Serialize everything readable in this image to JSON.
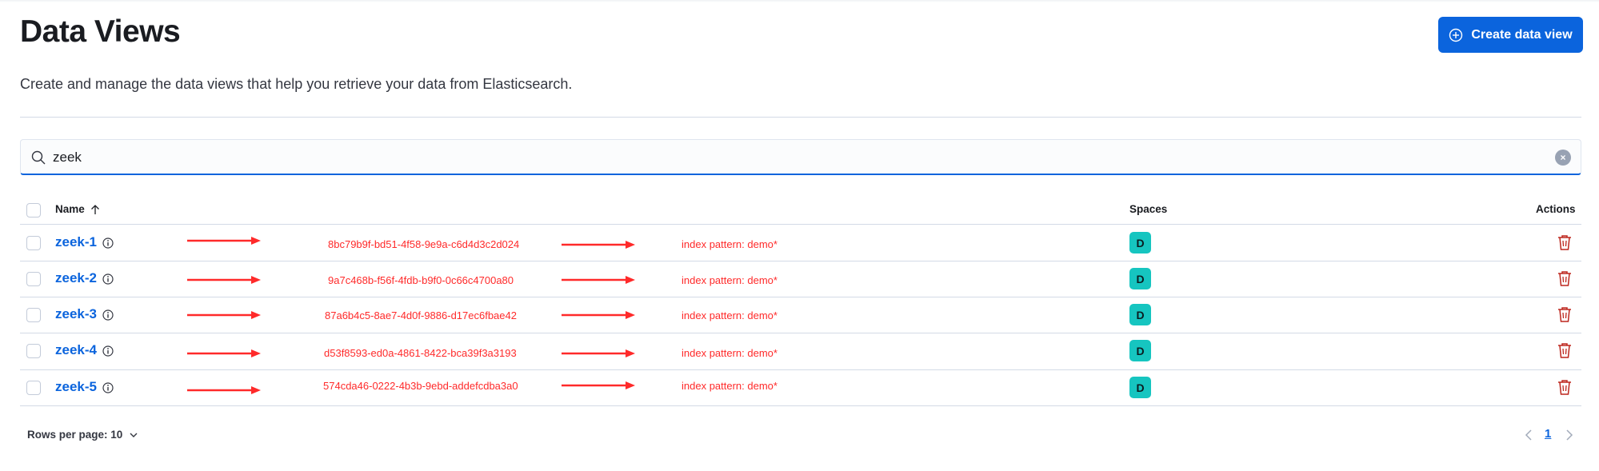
{
  "header": {
    "title": "Data Views",
    "subtitle": "Create and manage the data views that help you retrieve your data from Elasticsearch.",
    "create_button_label": "Create data view",
    "create_button_icon": "plus-circle-icon"
  },
  "search": {
    "value": "zeek"
  },
  "table": {
    "columns": {
      "name": "Name",
      "spaces": "Spaces",
      "actions": "Actions"
    },
    "rows": [
      {
        "name": "zeek-1",
        "annotation_id": "8bc79b9f-bd51-4f58-9e9a-c6d4d3c2d024",
        "annotation_pattern": "index pattern: demo*",
        "space_badge": "D"
      },
      {
        "name": "zeek-2",
        "annotation_id": "9a7c468b-f56f-4fdb-b9f0-0c66c4700a80",
        "annotation_pattern": "index pattern: demo*",
        "space_badge": "D"
      },
      {
        "name": "zeek-3",
        "annotation_id": "87a6b4c5-8ae7-4d0f-9886-d17ec6fbae42",
        "annotation_pattern": "index pattern: demo*",
        "space_badge": "D"
      },
      {
        "name": "zeek-4",
        "annotation_id": "d53f8593-ed0a-4861-8422-bca39f3a3193",
        "annotation_pattern": "index pattern: demo*",
        "space_badge": "D"
      },
      {
        "name": "zeek-5",
        "annotation_id": "574cda46-0222-4b3b-9ebd-addefcdba3a0",
        "annotation_pattern": "index pattern: demo*",
        "space_badge": "D"
      }
    ]
  },
  "pagination": {
    "rows_per_page_label": "Rows per page: 10",
    "current_page": "1"
  },
  "colors": {
    "primary": "#0b64dd",
    "annotation": "#ff2a2a",
    "space_badge": "#16c5c0",
    "danger": "#bd271e"
  }
}
